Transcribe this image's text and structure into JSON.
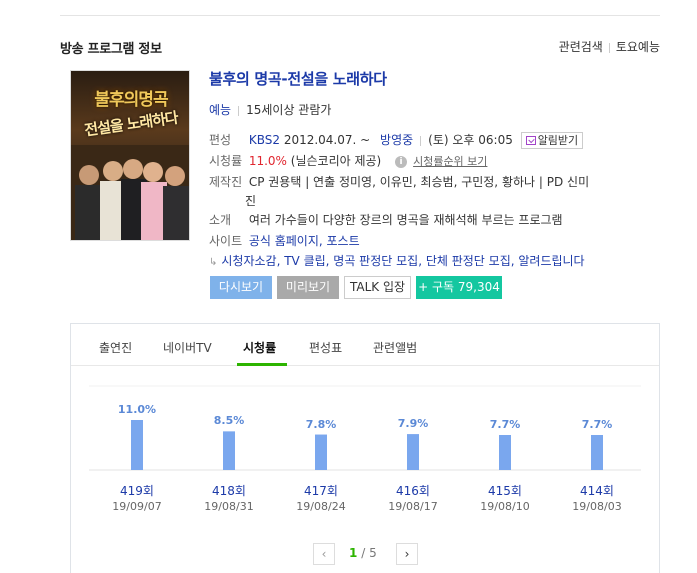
{
  "section": {
    "title": "방송 프로그램 정보",
    "links": [
      "관련검색",
      "토요예능"
    ]
  },
  "poster": {
    "title_line1": "불후의명곡",
    "title_line2": "전설을 노래하다"
  },
  "program": {
    "title": "불후의 명곡-전설을 노래하다",
    "genre": "예능",
    "rating": "15세이상 관람가",
    "schedule": {
      "label": "편성",
      "channel": "KBS2",
      "start": "2012.04.07. ~",
      "status": "방영중",
      "time": "(토) 오후 06:05",
      "alarm_label": "알림받기"
    },
    "viewership": {
      "label": "시청률",
      "value": "11.0%",
      "source": "(닐슨코리아 제공)",
      "rank_link": "시청률순위 보기"
    },
    "production": {
      "label": "제작진",
      "line1": "CP 권용택 | 연출 정미영, 이유민, 최승범, 구민정, 황하나 | PD 신미",
      "line2": "진"
    },
    "intro": {
      "label": "소개",
      "text": "여러 가수들이 다양한 장르의 명곡을 재해석해 부르는 프로그램"
    },
    "site": {
      "label": "사이트",
      "links": "공식 홈페이지, 포스트"
    },
    "extra_links": "시청자소감, TV 클립, 명곡 판정단 모집, 단체 판정단 모집, 알려드립니다"
  },
  "buttons": {
    "replay": "다시보기",
    "preview": "미리보기",
    "talk": "TALK 입장",
    "subscribe": "+ 구독 79,304"
  },
  "tabs": [
    "출연진",
    "네이버TV",
    "시청률",
    "편성표",
    "관련앨범"
  ],
  "active_tab": "시청률",
  "chart_data": {
    "type": "bar",
    "categories": [
      "419회",
      "418회",
      "417회",
      "416회",
      "415회",
      "414회"
    ],
    "dates": [
      "19/09/07",
      "19/08/31",
      "19/08/24",
      "19/08/17",
      "19/08/10",
      "19/08/03"
    ],
    "values": [
      11.0,
      8.5,
      7.8,
      7.9,
      7.7,
      7.7
    ],
    "value_labels": [
      "11.0%",
      "8.5%",
      "7.8%",
      "7.9%",
      "7.7%",
      "7.7%"
    ],
    "color": "#7aa7ee"
  },
  "pager": {
    "current": "1",
    "separator": "/",
    "total": "5",
    "prev_icon": "chevron-left-icon",
    "next_icon": "chevron-right-icon"
  }
}
